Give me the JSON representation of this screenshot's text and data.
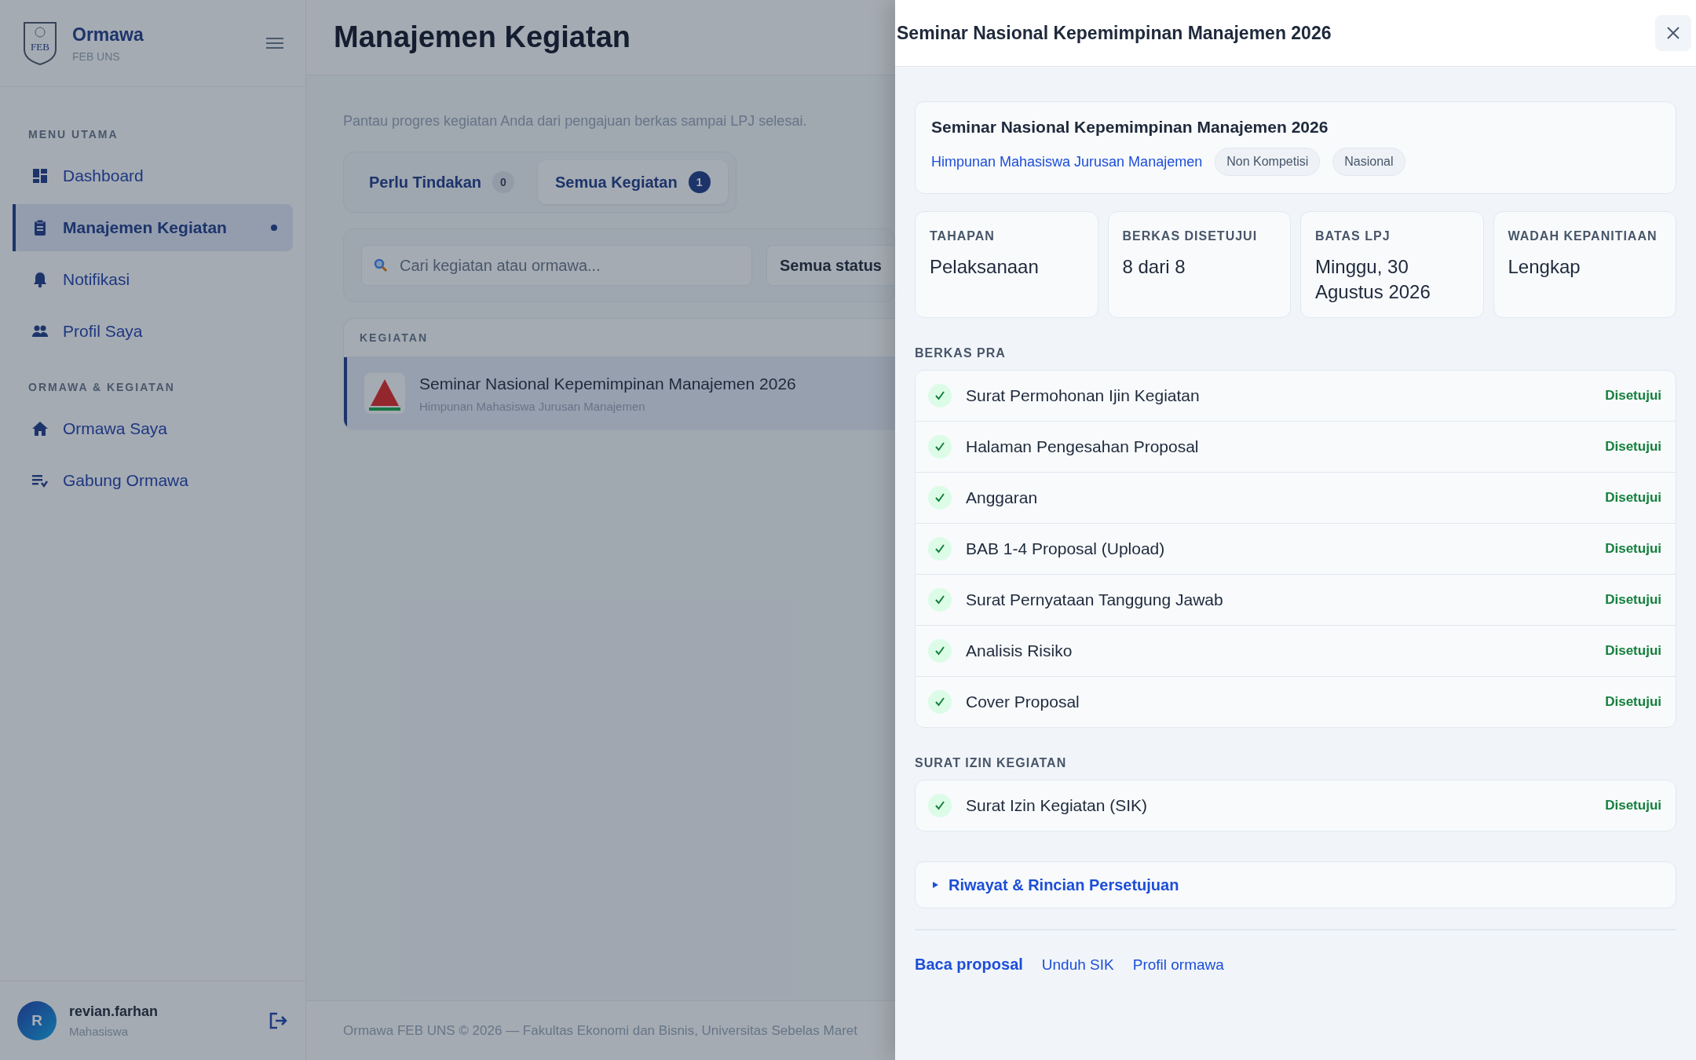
{
  "sidebar": {
    "brand": {
      "title": "Ormawa",
      "subtitle": "FEB UNS",
      "logo_text": "FEB"
    },
    "sections": [
      {
        "heading": "MENU UTAMA",
        "items": [
          {
            "label": "Dashboard",
            "selected": false
          },
          {
            "label": "Manajemen Kegiatan",
            "selected": true
          },
          {
            "label": "Notifikasi",
            "selected": false
          },
          {
            "label": "Profil Saya",
            "selected": false
          }
        ]
      },
      {
        "heading": "ORMAWA & KEGIATAN",
        "items": [
          {
            "label": "Ormawa Saya",
            "selected": false
          },
          {
            "label": "Gabung Ormawa",
            "selected": false
          }
        ]
      }
    ],
    "user": {
      "initial": "R",
      "name": "revian.farhan",
      "role": "Mahasiswa"
    }
  },
  "main": {
    "title": "Manajemen Kegiatan",
    "subtitle": "Pantau progres kegiatan Anda dari pengajuan berkas sampai LPJ selesai.",
    "tabs": [
      {
        "label": "Perlu Tindakan",
        "count": "0",
        "selected": false
      },
      {
        "label": "Semua Kegiatan",
        "count": "1",
        "selected": true
      }
    ],
    "search": {
      "placeholder": "Cari kegiatan atau ormawa..."
    },
    "filter": "Semua status",
    "table_heading": "KEGIATAN",
    "rows": [
      {
        "title": "Seminar Nasional Kepemimpinan Manajemen 2026",
        "org": "Himpunan Mahasiswa Jurusan Manajemen",
        "selected": true
      }
    ],
    "footer": "Ormawa FEB UNS © 2026 — Fakultas Ekonomi dan Bisnis, Universitas Sebelas Maret"
  },
  "drawer": {
    "title": "Seminar Nasional Kepemimpinan Manajemen 2026",
    "event": {
      "title": "Seminar Nasional Kepemimpinan Manajemen 2026",
      "org": "Himpunan Mahasiswa Jurusan Manajemen",
      "tags": [
        "Non Kompetisi",
        "Nasional"
      ]
    },
    "stats": [
      {
        "label": "TAHAPAN",
        "value": "Pelaksanaan"
      },
      {
        "label": "BERKAS DISETUJUI",
        "value": "8 dari 8"
      },
      {
        "label": "BATAS LPJ",
        "value": "Minggu, 30 Agustus 2026"
      },
      {
        "label": "WADAH KEPANITIAAN",
        "value": "Lengkap"
      }
    ],
    "sections": [
      {
        "heading": "BERKAS PRA",
        "items": [
          {
            "name": "Surat Permohonan Ijin Kegiatan",
            "status": "Disetujui",
            "checked": true
          },
          {
            "name": "Halaman Pengesahan Proposal",
            "status": "Disetujui",
            "checked": true
          },
          {
            "name": "Anggaran",
            "status": "Disetujui",
            "checked": true
          },
          {
            "name": "BAB 1-4 Proposal (Upload)",
            "status": "Disetujui",
            "checked": true
          },
          {
            "name": "Surat Pernyataan Tanggung Jawab",
            "status": "Disetujui",
            "checked": true
          },
          {
            "name": "Analisis Risiko",
            "status": "Disetujui",
            "checked": true
          },
          {
            "name": "Cover Proposal",
            "status": "Disetujui",
            "checked": true
          }
        ]
      },
      {
        "heading": "SURAT IZIN KEGIATAN",
        "items": [
          {
            "name": "Surat Izin Kegiatan (SIK)",
            "status": "Disetujui",
            "checked": true
          }
        ]
      }
    ],
    "details": {
      "label": "Riwayat & Rincian Persetujuan",
      "expanded": false
    },
    "links": [
      {
        "label": "Baca proposal",
        "kind": "primary"
      },
      {
        "label": "Unduh SIK",
        "kind": "link"
      },
      {
        "label": "Profil ormawa",
        "kind": "link"
      }
    ]
  }
}
